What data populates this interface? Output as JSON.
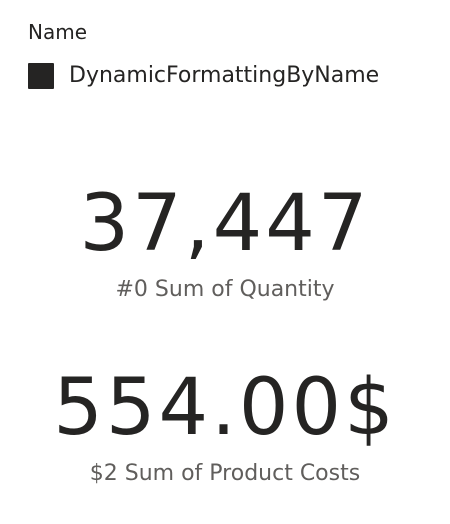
{
  "slicer": {
    "title": "Name",
    "items": [
      {
        "label": "DynamicFormattingByName",
        "checked": true
      }
    ]
  },
  "cards": [
    {
      "value": "37,447",
      "label": "#0 Sum of Quantity"
    },
    {
      "value": "554.00$",
      "label": "$2 Sum of Product Costs"
    }
  ],
  "colors": {
    "text": "#252423",
    "label": "#605E5C",
    "checkbox_fill": "#252423",
    "background": "#FFFFFF"
  }
}
